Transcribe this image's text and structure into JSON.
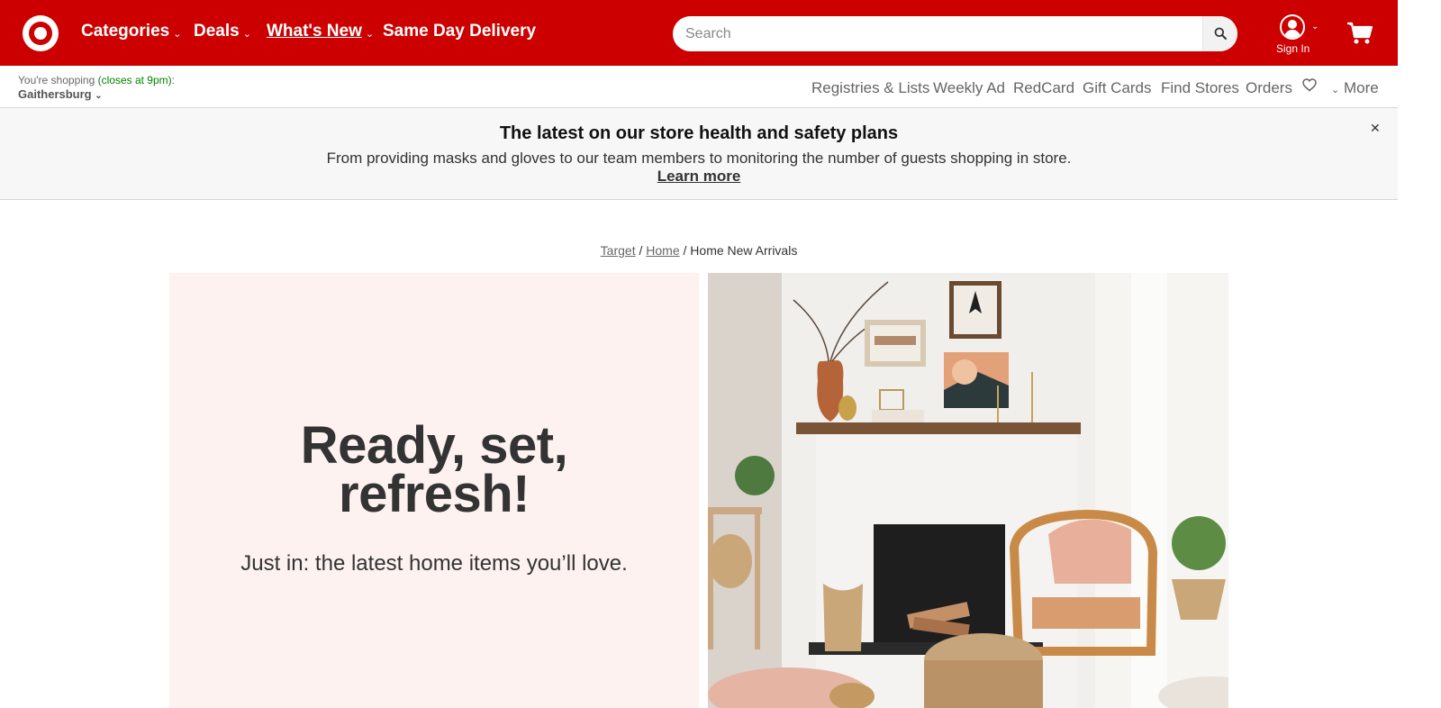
{
  "header": {
    "nav": [
      {
        "label": "Categories",
        "has_dropdown": true
      },
      {
        "label": "Deals",
        "has_dropdown": true
      },
      {
        "label": "What's New",
        "has_dropdown": true
      },
      {
        "label": "Same Day Delivery",
        "has_dropdown": false
      }
    ],
    "search": {
      "placeholder": "Search",
      "value": ""
    },
    "sign_in_label": "Sign In",
    "brand_color": "#cc0000"
  },
  "subheader": {
    "shopping_prefix": "You're shopping",
    "hours": "(closes at 9pm)",
    "store": "Gaithersburg",
    "links": [
      "Registries & Lists",
      "Weekly Ad",
      "RedCard",
      "Gift Cards",
      "Find Stores",
      "Orders"
    ],
    "more_label": "More"
  },
  "banner": {
    "title": "The latest on our store health and safety plans",
    "body": "From providing masks and gloves to our team members to monitoring the number of guests shopping in store.",
    "link": "Learn more"
  },
  "breadcrumb": {
    "items": [
      "Target",
      "Home"
    ],
    "current": "Home New Arrivals"
  },
  "hero": {
    "headline_line1": "Ready, set,",
    "headline_line2": "refresh!",
    "subtext": "Just in: the latest home items you’ll love."
  }
}
